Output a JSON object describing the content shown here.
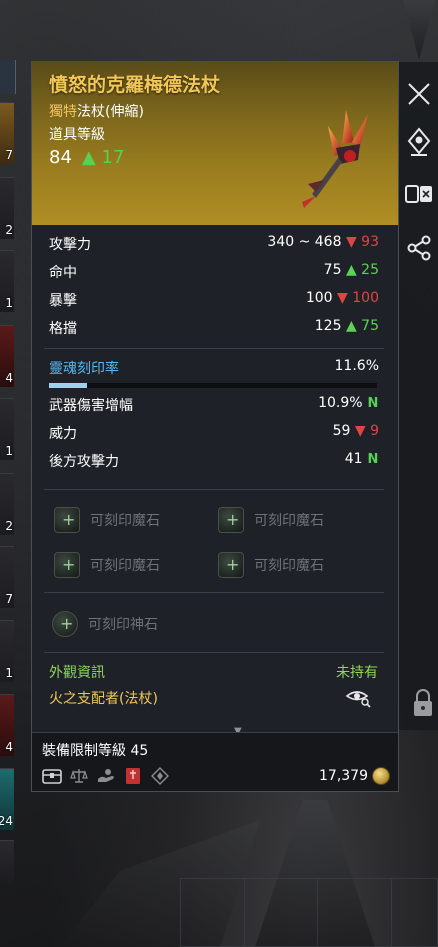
{
  "inventory": {
    "counts": [
      "7",
      "2",
      "1",
      "4",
      "1",
      "2",
      "7",
      "1",
      "4",
      "24",
      ""
    ]
  },
  "item": {
    "name": "憤怒的克羅梅德法杖",
    "grade": "獨特",
    "type": "法杖(伸縮)",
    "level_label": "道具等級",
    "level": "84",
    "level_diff": "17",
    "grade_color": "#f2c75a"
  },
  "stats": [
    {
      "label": "攻擊力",
      "value": "340 ~ 468",
      "delta": "93",
      "dir": "down"
    },
    {
      "label": "命中",
      "value": "75",
      "delta": "25",
      "dir": "up"
    },
    {
      "label": "暴擊",
      "value": "100",
      "delta": "100",
      "dir": "down"
    },
    {
      "label": "格擋",
      "value": "125",
      "delta": "75",
      "dir": "up"
    }
  ],
  "soul": {
    "label": "靈魂刻印率",
    "value": "11.6%",
    "fill_fraction": 0.116
  },
  "stats2": [
    {
      "label": "武器傷害增幅",
      "value": "10.9%",
      "badge": "N"
    },
    {
      "label": "威力",
      "value": "59",
      "delta": "9",
      "dir": "down"
    },
    {
      "label": "後方攻擊力",
      "value": "41",
      "badge": "N"
    }
  ],
  "engrave_slots": {
    "magic_stone": "可刻印魔石",
    "god_stone": "可刻印神石"
  },
  "appearance": {
    "label": "外觀資訊",
    "status": "未持有",
    "name": "火之支配者(法杖)"
  },
  "footer": {
    "req_label": "裝備限制等級 45",
    "price": "17,379"
  },
  "colors": {
    "up": "#5ed253",
    "down": "#e04545",
    "soul": "#58b8f0",
    "appearance": "#8fd85a"
  }
}
